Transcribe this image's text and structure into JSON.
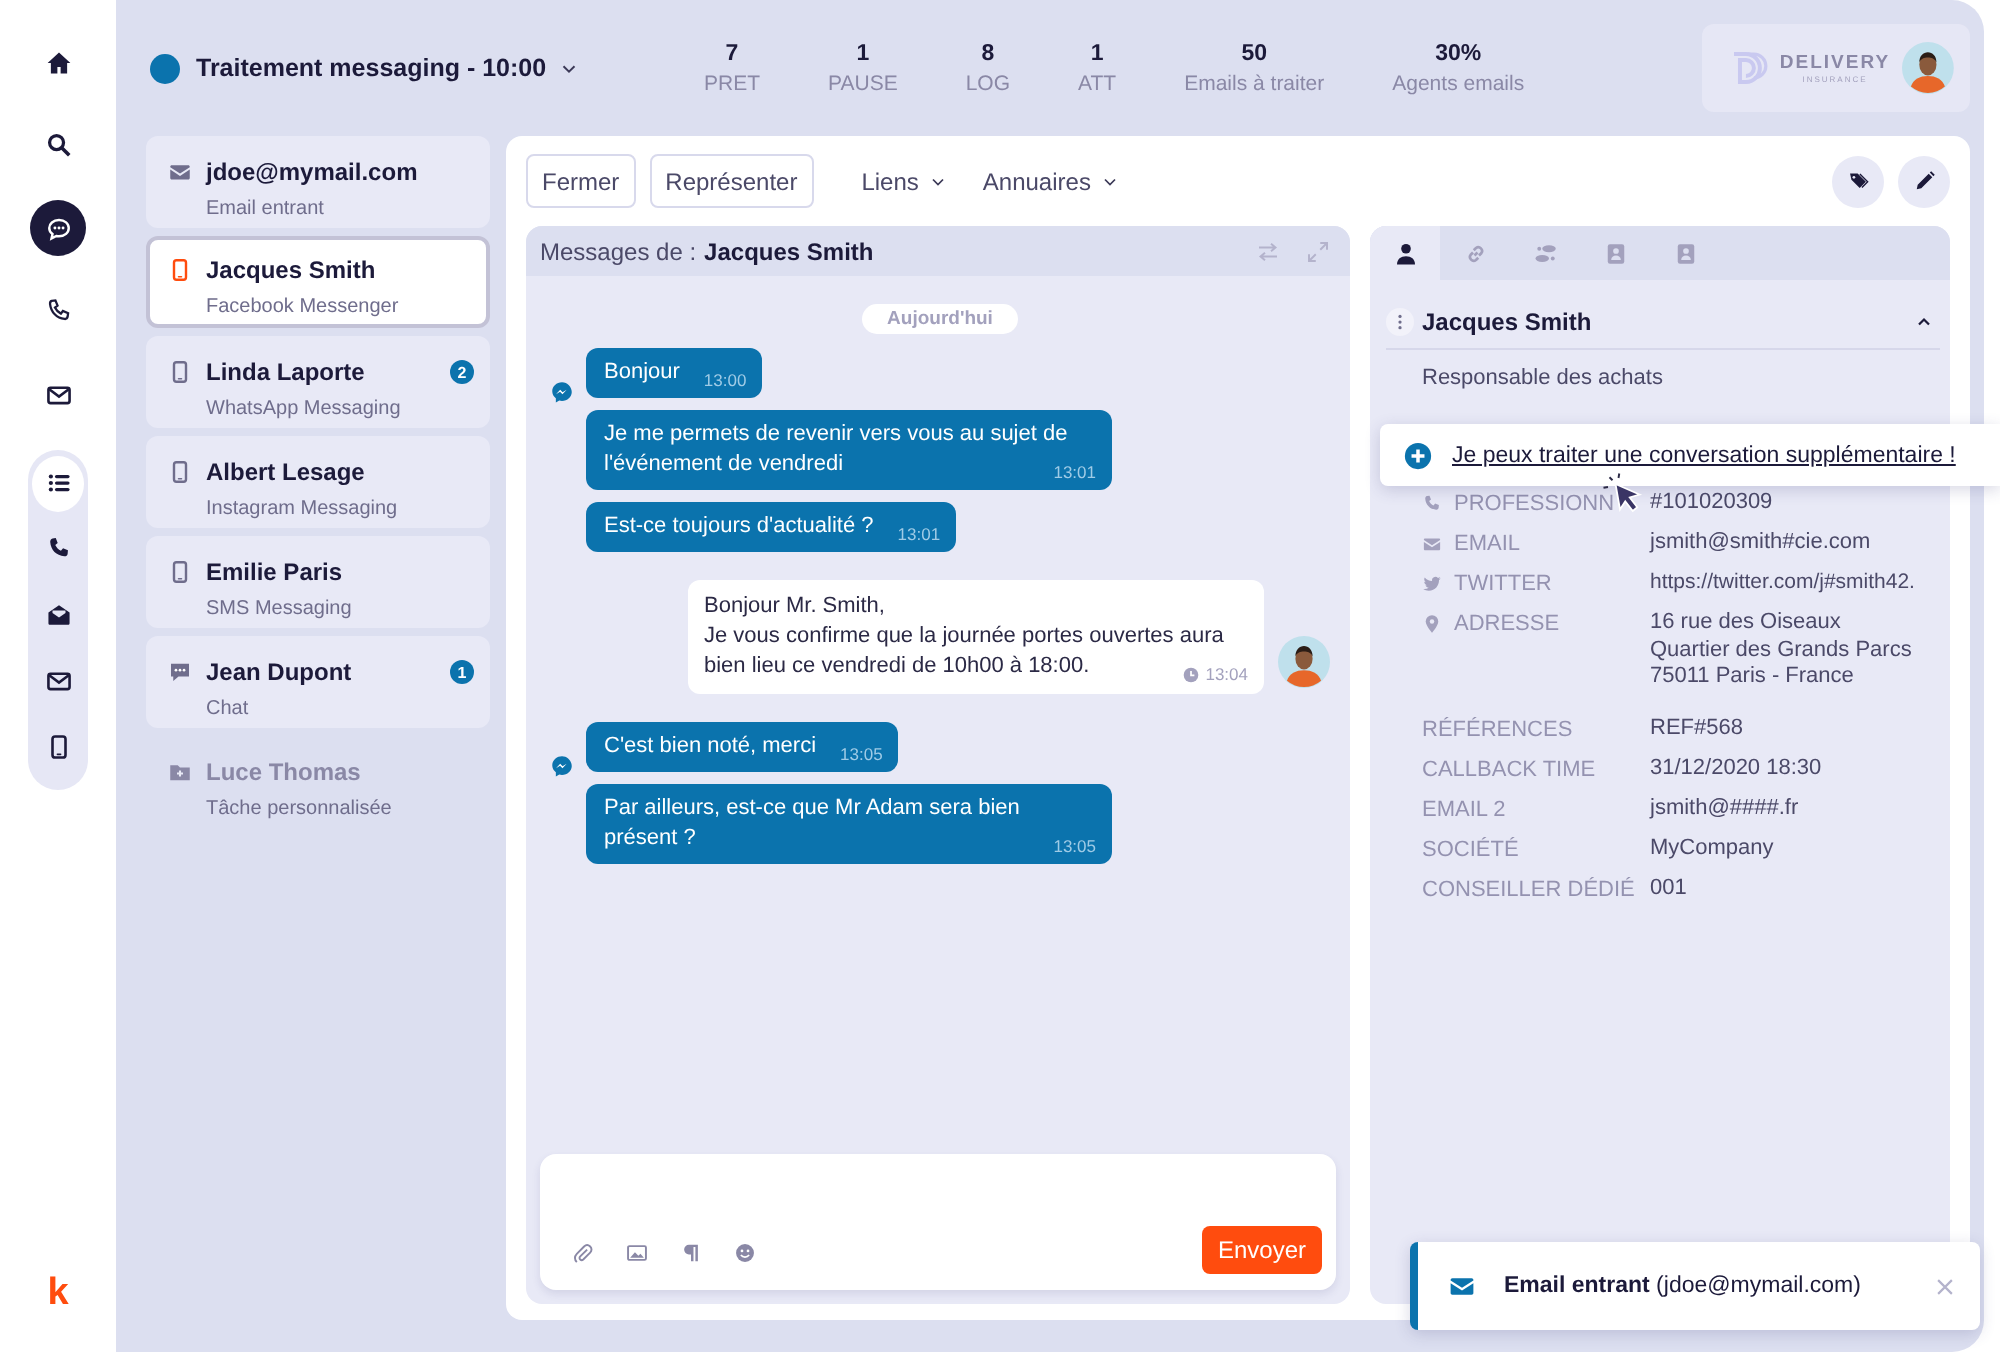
{
  "brand": "k",
  "nav": {
    "main": [
      {
        "kind": "home",
        "selected": false
      },
      {
        "kind": "search",
        "selected": false
      },
      {
        "kind": "chat",
        "selected": true
      },
      {
        "kind": "phone",
        "selected": false
      },
      {
        "kind": "mail",
        "selected": false
      }
    ],
    "channels": [
      {
        "kind": "list",
        "selected": true
      },
      {
        "kind": "handset",
        "selected": false
      },
      {
        "kind": "mail-open",
        "selected": false
      },
      {
        "kind": "mail",
        "selected": false
      },
      {
        "kind": "mobile",
        "selected": false
      }
    ]
  },
  "header": {
    "title": "Traitement messaging - 10:00",
    "stats": [
      {
        "value": "7",
        "label": "PRET"
      },
      {
        "value": "1",
        "label": "PAUSE"
      },
      {
        "value": "8",
        "label": "LOG"
      },
      {
        "value": "1",
        "label": "ATT"
      },
      {
        "value": "50",
        "label": "Emails à traiter"
      },
      {
        "value": "30%",
        "label": "Agents emails"
      }
    ],
    "logo": {
      "name": "DELIVERY",
      "tagline": "INSURANCE"
    }
  },
  "conversations": [
    {
      "name": "jdoe@mymail.com",
      "channel": "Email entrant",
      "kind": "mail",
      "selected": false,
      "disabled": false
    },
    {
      "name": "Jacques Smith",
      "channel": "Facebook Messenger",
      "kind": "mobile",
      "selected": true,
      "disabled": false
    },
    {
      "name": "Linda Laporte",
      "channel": "WhatsApp Messaging",
      "kind": "mobile",
      "selected": false,
      "disabled": false,
      "badge": "2"
    },
    {
      "name": "Albert Lesage",
      "channel": "Instagram Messaging",
      "kind": "mobile",
      "selected": false,
      "disabled": false
    },
    {
      "name": "Emilie Paris",
      "channel": "SMS Messaging",
      "kind": "mobile",
      "selected": false,
      "disabled": false
    },
    {
      "name": "Jean Dupont",
      "channel": "Chat",
      "kind": "chat",
      "selected": false,
      "disabled": false,
      "badge": "1"
    },
    {
      "name": "Luce Thomas",
      "channel": "Tâche personnalisée",
      "kind": "task",
      "selected": false,
      "disabled": true
    }
  ],
  "toolbar": {
    "buttons": [
      "Fermer",
      "Représenter"
    ],
    "menus": [
      "Liens",
      "Annuaires"
    ]
  },
  "chat": {
    "title_prefix": "Messages de :",
    "title_name": "Jacques Smith",
    "date": "Aujourd'hui",
    "groups": [
      {
        "kind": "incoming",
        "messages": [
          {
            "text": "Bonjour",
            "time": "13:00"
          },
          {
            "text": "Je me permets de revenir vers vous au sujet de l'événement de vendredi",
            "time": "13:01"
          },
          {
            "text": "Est-ce toujours d'actualité ?",
            "time": "13:01"
          }
        ]
      },
      {
        "kind": "outgoing",
        "messages": [
          {
            "text": "Bonjour Mr. Smith,\nJe vous confirme que la journée portes ouvertes aura bien lieu ce vendredi de 10h00 à 18:00.",
            "time": "13:04"
          }
        ]
      },
      {
        "kind": "incoming",
        "messages": [
          {
            "text": "C'est bien noté, merci",
            "time": "13:05"
          },
          {
            "text": "Par ailleurs, est-ce que Mr Adam sera bien présent ?",
            "time": "13:05"
          }
        ]
      }
    ],
    "send": "Envoyer"
  },
  "contact": {
    "tabs": [
      {
        "kind": "person",
        "selected": true
      },
      {
        "kind": "link",
        "selected": false
      },
      {
        "kind": "steps",
        "selected": false
      },
      {
        "kind": "card",
        "selected": false
      },
      {
        "kind": "card",
        "selected": false
      }
    ],
    "name": "Jacques Smith",
    "expanded": true,
    "role": "Responsable des achats",
    "fields": [
      {
        "kind": "phone",
        "label": "PROFESSIONN",
        "value": "#101020309"
      },
      {
        "kind": "mail",
        "label": "EMAIL",
        "value": "jsmith@smith#cie.com"
      },
      {
        "kind": "twitter",
        "label": "TWITTER",
        "value": "https://twitter.com/j#smith42."
      },
      {
        "kind": "pin",
        "label": "ADRESSE",
        "value": "16 rue des Oiseaux\nQuartier des Grands Parcs\n75011 Paris - France"
      },
      {
        "kind": "plain",
        "label": "RÉFÉRENCES",
        "value": "REF#568"
      },
      {
        "kind": "plain",
        "label": "CALLBACK TIME",
        "value": "31/12/2020 18:30"
      },
      {
        "kind": "plain",
        "label": "EMAIL 2",
        "value": "jsmith@####.fr"
      },
      {
        "kind": "plain",
        "label": "SOCIÉTÉ",
        "value": "MyCompany"
      },
      {
        "kind": "plain",
        "label": "CONSEILLER DÉDIÉ",
        "value": "001"
      }
    ]
  },
  "prompt": "Je peux traiter une conversation supplémentaire !",
  "toast": "**Email entrant** (jdoe@mymail.com)"
}
